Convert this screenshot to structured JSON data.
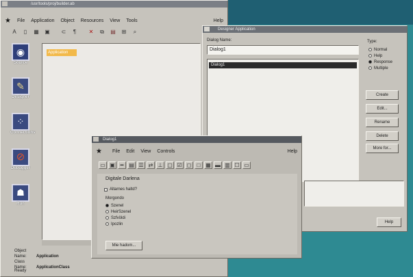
{
  "builder": {
    "title": "/usr/tools/proj/builder.ab",
    "menu": [
      "File",
      "Application",
      "Object",
      "Resources",
      "View",
      "Tools"
    ],
    "help": "Help",
    "palette": [
      "Source",
      "Designer",
      "Connections",
      "Debugger",
      "Run"
    ],
    "canvas_object": "Application",
    "info": {
      "object_name_label": "Object Name:",
      "object_name": "Application",
      "class_name_label": "Class Name:",
      "class_name": "ApplicationClass"
    },
    "status": "Ready"
  },
  "dialogs": {
    "title": "Designer Application",
    "dialog_name_label": "Dialog Name:",
    "dialog_name_value": "Dialog1",
    "list_selected": "Dialog1",
    "type_label": "Type:",
    "types": [
      "Normal",
      "Help",
      "Response",
      "Multiple"
    ],
    "selected_type": "Response",
    "buttons": [
      "Create",
      "Edit...",
      "Rename",
      "Delete",
      "More for..."
    ],
    "help_button": "Help"
  },
  "dialog1": {
    "title": "Dialog1",
    "menu": [
      "File",
      "Edit",
      "View",
      "Controls"
    ],
    "help": "Help",
    "heading": "Digitale Darlena",
    "checkbox": "Altarnes haltd?",
    "group_label": "Morgondo",
    "radios": [
      "Szenel",
      "HeirSzenel",
      "Szfvöldi",
      "Ipozlin"
    ],
    "selected_radio": "Szenel",
    "more_button": "Mie hadom..."
  }
}
